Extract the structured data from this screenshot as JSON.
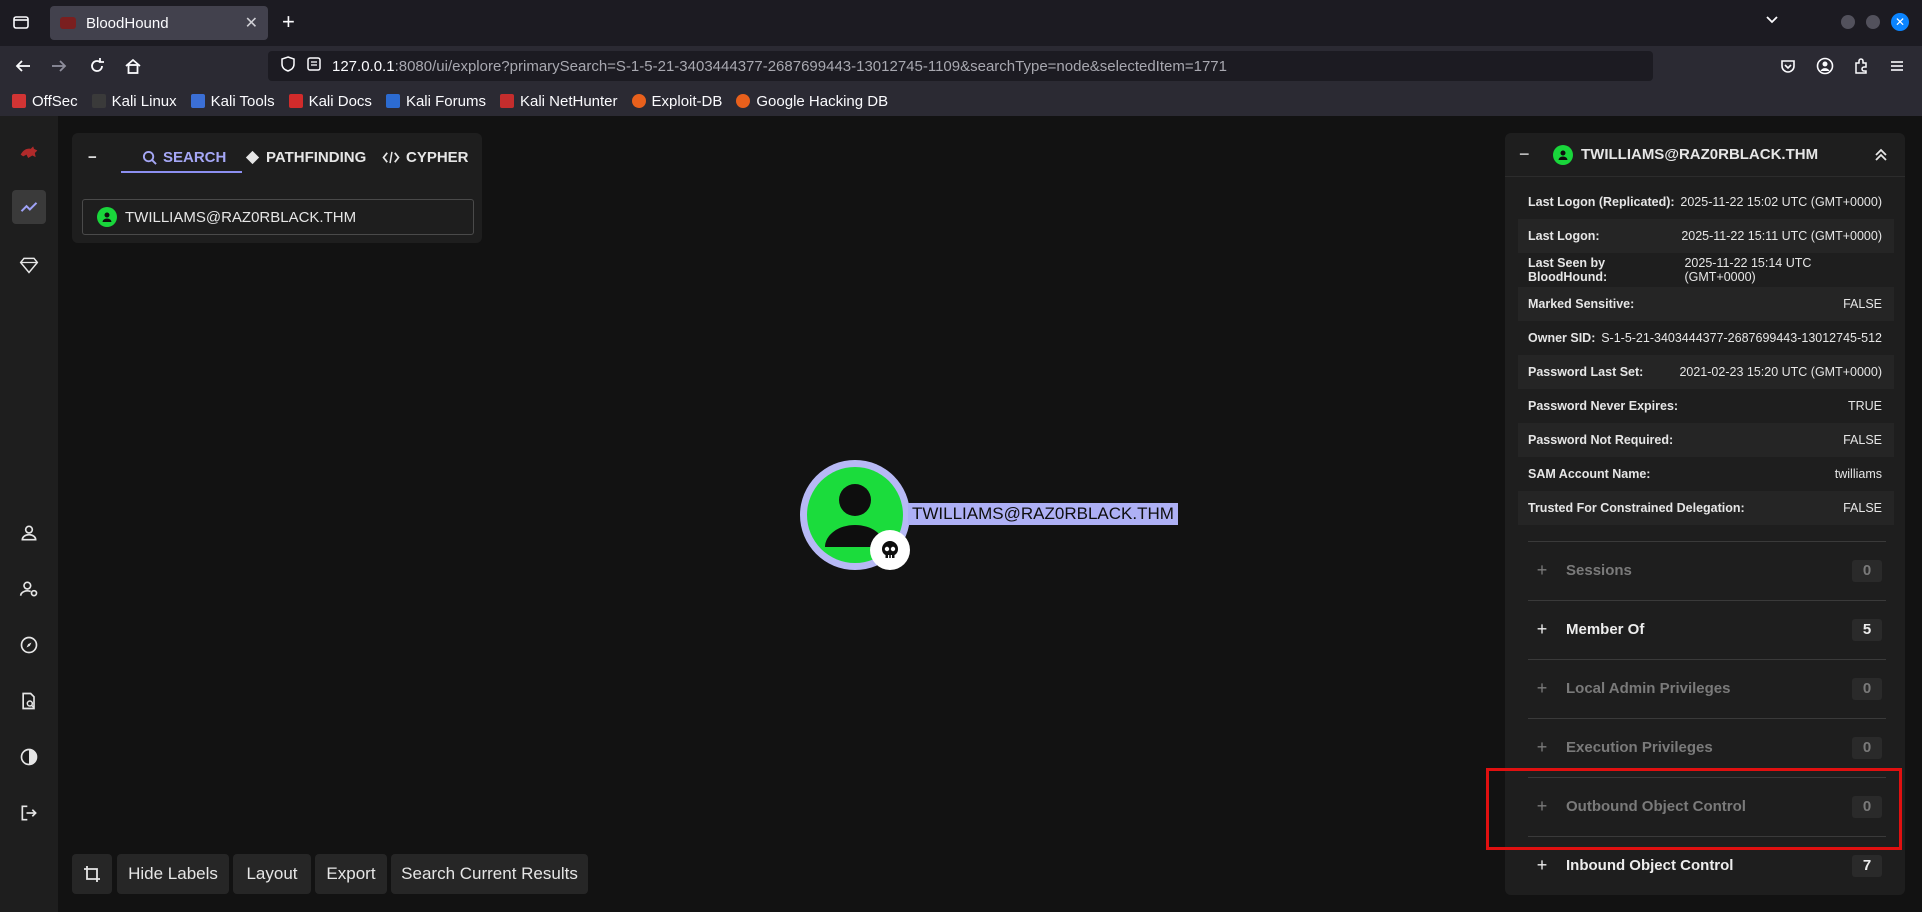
{
  "browser": {
    "tab_title": "BloodHound",
    "url_host": "127.0.0.1",
    "url_rest": ":8080/ui/explore?primarySearch=S-1-5-21-3403444377-2687699443-13012745-1109&searchType=node&selectedItem=1771",
    "bookmarks": [
      "OffSec",
      "Kali Linux",
      "Kali Tools",
      "Kali Docs",
      "Kali Forums",
      "Kali NetHunter",
      "Exploit-DB",
      "Google Hacking DB"
    ]
  },
  "search_panel": {
    "collapse_label": "−",
    "tabs": [
      "SEARCH",
      "PATHFINDING",
      "CYPHER"
    ],
    "node_value": "TWILLIAMS@RAZ0RBLACK.THM"
  },
  "graph": {
    "node_label": "TWILLIAMS@RAZ0RBLACK.THM"
  },
  "toolbar": {
    "hide_labels": "Hide Labels",
    "layout": "Layout",
    "export": "Export",
    "search_current": "Search Current Results"
  },
  "entity_panel": {
    "title": "TWILLIAMS@RAZ0RBLACK.THM",
    "properties": [
      {
        "key": "Last Logon (Replicated):",
        "value": "2025-11-22 15:02 UTC (GMT+0000)"
      },
      {
        "key": "Last Logon:",
        "value": "2025-11-22 15:11 UTC (GMT+0000)"
      },
      {
        "key": "Last Seen by BloodHound:",
        "value": "2025-11-22 15:14 UTC (GMT+0000)"
      },
      {
        "key": "Marked Sensitive:",
        "value": "FALSE"
      },
      {
        "key": "Owner SID:",
        "value": "S-1-5-21-3403444377-2687699443-13012745-512"
      },
      {
        "key": "Password Last Set:",
        "value": "2021-02-23 15:20 UTC (GMT+0000)"
      },
      {
        "key": "Password Never Expires:",
        "value": "TRUE"
      },
      {
        "key": "Password Not Required:",
        "value": "FALSE"
      },
      {
        "key": "SAM Account Name:",
        "value": "twilliams"
      },
      {
        "key": "Trusted For Constrained Delegation:",
        "value": "FALSE"
      }
    ],
    "sections": [
      {
        "label": "Sessions",
        "count": "0",
        "active": false
      },
      {
        "label": "Member Of",
        "count": "5",
        "active": true
      },
      {
        "label": "Local Admin Privileges",
        "count": "0",
        "active": false
      },
      {
        "label": "Execution Privileges",
        "count": "0",
        "active": false
      },
      {
        "label": "Outbound Object Control",
        "count": "0",
        "active": false
      },
      {
        "label": "Inbound Object Control",
        "count": "7",
        "active": true
      }
    ]
  },
  "colors": {
    "accent": "#8c8ff0",
    "node_green": "#1bdc3c",
    "highlight_red": "#e01010"
  }
}
